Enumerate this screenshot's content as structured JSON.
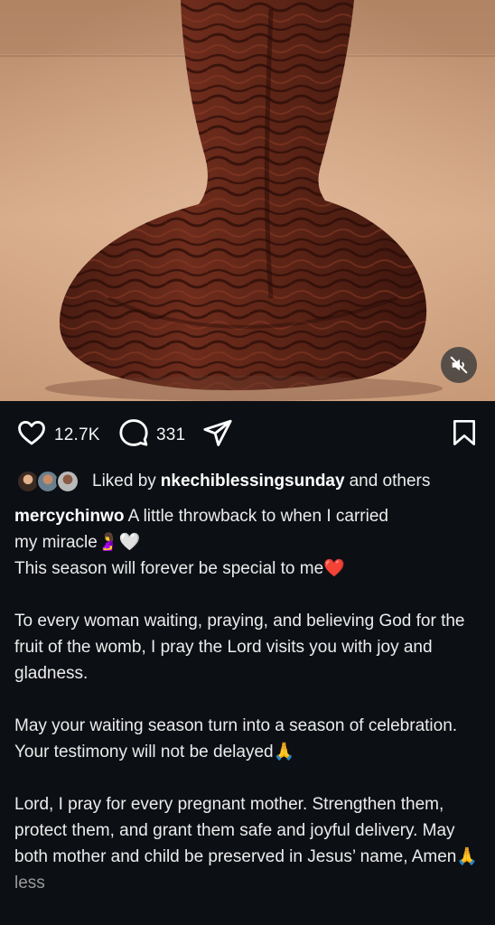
{
  "post": {
    "likes_count": "12.7K",
    "comments_count": "331"
  },
  "liked_by": {
    "prefix": "Liked by",
    "user": "nkechiblessingsunday",
    "suffix": "and others"
  },
  "caption": {
    "username": "mercychinwo",
    "line1": "A little throwback to when I carried",
    "line2": "my miracle",
    "line2_emoji": "🤰🤍",
    "line3": "This season will forever be special to me",
    "line3_emoji": "❤️",
    "para2": "To every woman waiting, praying, and believing God for the fruit of the womb, I pray the Lord visits you with joy and gladness.",
    "para3a": "May your waiting season turn into a season of celebration.",
    "para3b": "Your testimony will not be delayed",
    "pray_emoji": "🙏",
    "para4": "Lord, I pray for every pregnant mother. Strengthen them, protect them, and grant them safe and joyful delivery. May both mother and child be preserved in Jesus’ name, Amen",
    "less_label": "less"
  },
  "icons": {
    "like": "heart-icon",
    "comment": "comment-icon",
    "share": "send-icon",
    "save": "bookmark-icon",
    "mute": "speaker-muted-icon"
  },
  "colors": {
    "background": "#0c0f14",
    "text": "#ececec",
    "muted_text": "#9a9a9a",
    "heart_emoji": "#e4262f"
  }
}
